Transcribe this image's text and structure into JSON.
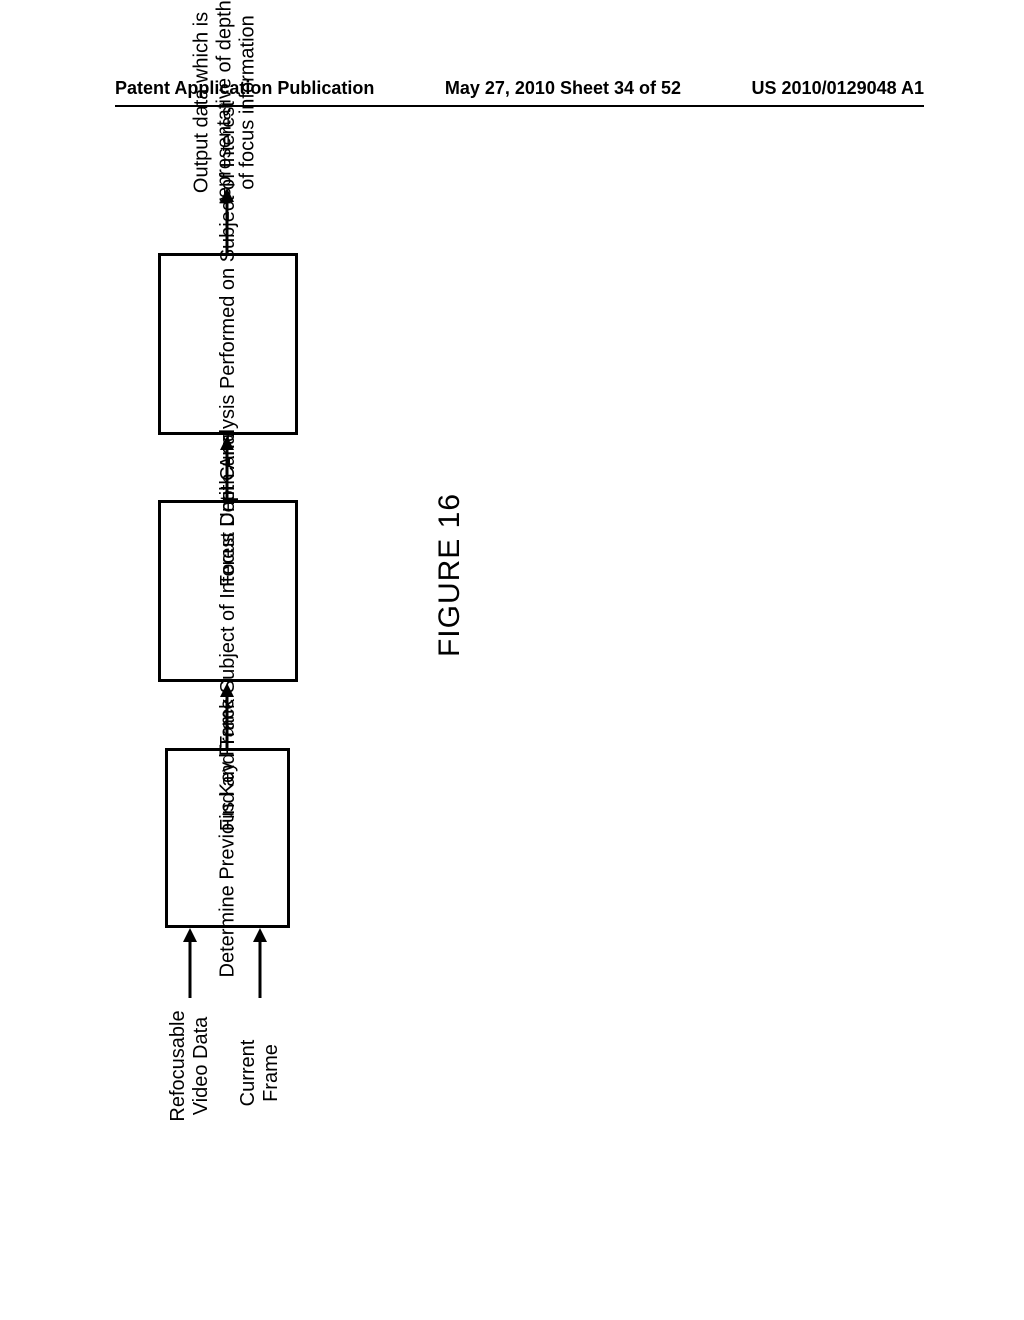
{
  "header": {
    "left": "Patent Application Publication",
    "center": "May 27, 2010  Sheet 34 of 52",
    "right": "US 2010/0129048 A1"
  },
  "inputs": {
    "in1": "Refocusable\nVideo Data",
    "in2": "Current\nFrame"
  },
  "boxes": {
    "b1": "Determine\nPrevious Key\nFrame",
    "b2": "Find and Track\nSubject of\nInterest Until\nCurrent Frame",
    "b3": "Focus Depth\nAnalysis\nPerformed on\nSubject of\nInterest"
  },
  "output": "Output data which is\nrepresentative of depth\nof focus information",
  "figure": "FIGURE 16"
}
